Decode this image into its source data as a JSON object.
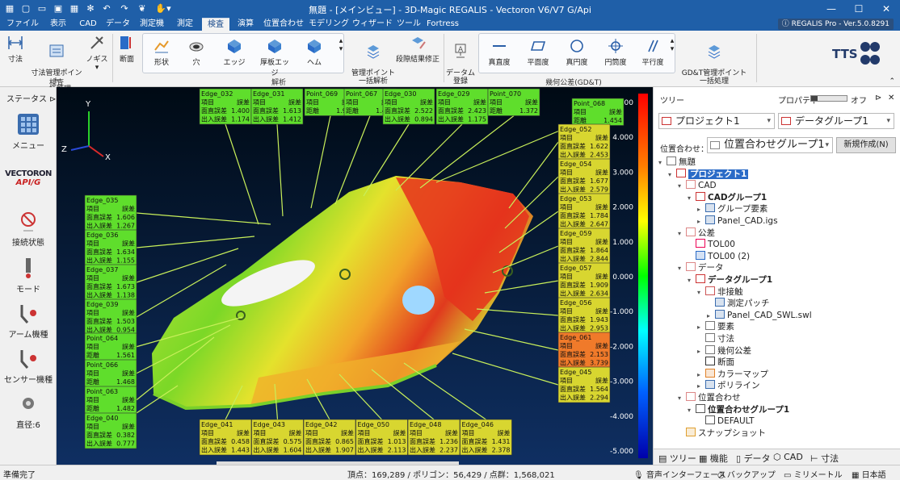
{
  "titlebar": {
    "title": "無題 - [メインビュー] - 3D-Magic REGALIS - Vectoron V6/V7 G/Api"
  },
  "menu": {
    "items": [
      "ファイル",
      "表示",
      "CAD",
      "データ",
      "測定機",
      "測定",
      "検査",
      "演算",
      "位置合わせ",
      "モデリング",
      "ウィザード",
      "ツール",
      "Fortress"
    ],
    "active": "検査",
    "version_badge": "REGALIS Pro - Ver.5.0.8291"
  },
  "ribbon": {
    "dim": "寸法",
    "dim_batch": "寸法管理ポイント\n一括処理",
    "caliper": "ノギス",
    "section": "断面",
    "group_measure": "検査",
    "shape": "形状",
    "hole": "穴",
    "edge": "エッジ",
    "thick_edge": "厚板エッジ",
    "hem": "ヘム",
    "mgmt_batch": "管理ポイント\n一括解析",
    "step_fix": "段隙結果修正",
    "group_analysis": "解析",
    "datum": "データム\n登録",
    "straightness": "真直度",
    "flatness": "平面度",
    "roundness": "真円度",
    "cylindricity": "円筒度",
    "parallelism": "平行度",
    "gdt_batch": "GD&T管理ポイント\n一括処理",
    "group_gdt": "幾何公差(GD&T)",
    "logo": "TTS"
  },
  "left_panel": {
    "status_title": "ステータス",
    "menu": "メニュー",
    "brand_top": "VECTORON",
    "brand_bottom": "API/G",
    "connection": "接続状態",
    "mode": "モード",
    "arm": "アーム機種",
    "sensor": "センサー機種",
    "diameter": "直径:6"
  },
  "scale": {
    "ticks": [
      "5.000",
      "4.000",
      "3.000",
      "2.000",
      "1.000",
      "0.000",
      "-1.000",
      "-2.000",
      "-3.000",
      "-4.000",
      "-5.000"
    ]
  },
  "callouts": [
    {
      "name": "Edge_032",
      "r1": [
        "項目",
        "誤差"
      ],
      "r2": [
        "面直誤差",
        "1.400"
      ],
      "r3": [
        "出入誤差",
        "1.174"
      ],
      "color": "#5fde2c"
    },
    {
      "name": "Edge_031",
      "r1": [
        "項目",
        "誤差"
      ],
      "r2": [
        "面直誤差",
        "1.613"
      ],
      "r3": [
        "出入誤差",
        "1.412"
      ],
      "color": "#5fde2c"
    },
    {
      "name": "Point_069",
      "r1": [
        "項目",
        "誤差"
      ],
      "r2": [
        "距離",
        "1.967"
      ],
      "r3": null,
      "color": "#5fde2c"
    },
    {
      "name": "Point_067",
      "r1": [
        "項目",
        "誤差"
      ],
      "r2": [
        "距離",
        "1.485"
      ],
      "r3": null,
      "color": "#5fde2c"
    },
    {
      "name": "Edge_030",
      "r1": [
        "項目",
        "誤差"
      ],
      "r2": [
        "面直誤差",
        "2.522"
      ],
      "r3": [
        "出入誤差",
        "0.894"
      ],
      "color": "#5fde2c"
    },
    {
      "name": "Edge_029",
      "r1": [
        "項目",
        "誤差"
      ],
      "r2": [
        "面直誤差",
        "2.423"
      ],
      "r3": [
        "出入誤差",
        "1.175"
      ],
      "color": "#5fde2c"
    },
    {
      "name": "Point_070",
      "r1": [
        "項目",
        "誤差"
      ],
      "r2": [
        "距離",
        "1.372"
      ],
      "r3": null,
      "color": "#5fde2c"
    },
    {
      "name": "Point_068",
      "r1": [
        "項目",
        "誤差"
      ],
      "r2": [
        "距離",
        "1.454"
      ],
      "r3": null,
      "color": "#5fde2c"
    },
    {
      "name": "Edge_052",
      "r1": [
        "項目",
        "誤差"
      ],
      "r2": [
        "面直誤差",
        "1.622"
      ],
      "r3": [
        "出入誤差",
        "2.453"
      ],
      "color": "#d8d630"
    },
    {
      "name": "Edge_054",
      "r1": [
        "項目",
        "誤差"
      ],
      "r2": [
        "面直誤差",
        "1.677"
      ],
      "r3": [
        "出入誤差",
        "2.579"
      ],
      "color": "#d8d630"
    },
    {
      "name": "Edge_053",
      "r1": [
        "項目",
        "誤差"
      ],
      "r2": [
        "面直誤差",
        "1.784"
      ],
      "r3": [
        "出入誤差",
        "2.647"
      ],
      "color": "#d8d630"
    },
    {
      "name": "Edge_059",
      "r1": [
        "項目",
        "誤差"
      ],
      "r2": [
        "面直誤差",
        "1.864"
      ],
      "r3": [
        "出入誤差",
        "2.844"
      ],
      "color": "#d8d630"
    },
    {
      "name": "Edge_057",
      "r1": [
        "項目",
        "誤差"
      ],
      "r2": [
        "面直誤差",
        "1.909"
      ],
      "r3": [
        "出入誤差",
        "2.634"
      ],
      "color": "#d8d630"
    },
    {
      "name": "Edge_056",
      "r1": [
        "項目",
        "誤差"
      ],
      "r2": [
        "面直誤差",
        "1.943"
      ],
      "r3": [
        "出入誤差",
        "2.953"
      ],
      "color": "#d8d630"
    },
    {
      "name": "Edge_061",
      "r1": [
        "項目",
        "誤差"
      ],
      "r2": [
        "面直誤差",
        "2.153"
      ],
      "r3": [
        "出入誤差",
        "3.739"
      ],
      "color": "#f07a2a"
    },
    {
      "name": "Edge_045",
      "r1": [
        "項目",
        "誤差"
      ],
      "r2": [
        "面直誤差",
        "1.564"
      ],
      "r3": [
        "出入誤差",
        "2.294"
      ],
      "color": "#d8d630"
    },
    {
      "name": "Edge_035",
      "r1": [
        "項目",
        "誤差"
      ],
      "r2": [
        "面直誤差",
        "1.606"
      ],
      "r3": [
        "出入誤差",
        "1.267"
      ],
      "color": "#5fde2c"
    },
    {
      "name": "Edge_036",
      "r1": [
        "項目",
        "誤差"
      ],
      "r2": [
        "面直誤差",
        "1.634"
      ],
      "r3": [
        "出入誤差",
        "1.155"
      ],
      "color": "#5fde2c"
    },
    {
      "name": "Edge_037",
      "r1": [
        "項目",
        "誤差"
      ],
      "r2": [
        "面直誤差",
        "1.673"
      ],
      "r3": [
        "出入誤差",
        "1.138"
      ],
      "color": "#5fde2c"
    },
    {
      "name": "Edge_039",
      "r1": [
        "項目",
        "誤差"
      ],
      "r2": [
        "面直誤差",
        "1.503"
      ],
      "r3": [
        "出入誤差",
        "0.954"
      ],
      "color": "#5fde2c"
    },
    {
      "name": "Point_064",
      "r1": [
        "項目",
        "誤差"
      ],
      "r2": [
        "距離",
        "1.561"
      ],
      "r3": null,
      "color": "#5fde2c"
    },
    {
      "name": "Point_066",
      "r1": [
        "項目",
        "誤差"
      ],
      "r2": [
        "距離",
        "1.468"
      ],
      "r3": null,
      "color": "#5fde2c"
    },
    {
      "name": "Point_063",
      "r1": [
        "項目",
        "誤差"
      ],
      "r2": [
        "距離",
        "1.482"
      ],
      "r3": null,
      "color": "#5fde2c"
    },
    {
      "name": "Edge_040",
      "r1": [
        "項目",
        "誤差"
      ],
      "r2": [
        "面直誤差",
        "0.382"
      ],
      "r3": [
        "出入誤差",
        "0.777"
      ],
      "color": "#5fde2c"
    },
    {
      "name": "Edge_041",
      "r1": [
        "項目",
        "誤差"
      ],
      "r2": [
        "面直誤差",
        "0.458"
      ],
      "r3": [
        "出入誤差",
        "1.443"
      ],
      "color": "#d8d630"
    },
    {
      "name": "Edge_043",
      "r1": [
        "項目",
        "誤差"
      ],
      "r2": [
        "面直誤差",
        "0.575"
      ],
      "r3": [
        "出入誤差",
        "1.604"
      ],
      "color": "#d8d630"
    },
    {
      "name": "Edge_042",
      "r1": [
        "項目",
        "誤差"
      ],
      "r2": [
        "面直誤差",
        "0.865"
      ],
      "r3": [
        "出入誤差",
        "1.907"
      ],
      "color": "#d8d630"
    },
    {
      "name": "Edge_050",
      "r1": [
        "項目",
        "誤差"
      ],
      "r2": [
        "面直誤差",
        "1.013"
      ],
      "r3": [
        "出入誤差",
        "2.113"
      ],
      "color": "#d8d630"
    },
    {
      "name": "Edge_048",
      "r1": [
        "項目",
        "誤差"
      ],
      "r2": [
        "面直誤差",
        "1.236"
      ],
      "r3": [
        "出入誤差",
        "2.237"
      ],
      "color": "#d8d630"
    },
    {
      "name": "Edge_046",
      "r1": [
        "項目",
        "誤差"
      ],
      "r2": [
        "面直誤差",
        "1.431"
      ],
      "r3": [
        "出入誤差",
        "2.378"
      ],
      "color": "#d8d630"
    }
  ],
  "right_panel": {
    "tree_label": "ツリー",
    "property_label": "プロパティ",
    "toggle_off": "オフ",
    "project_combo": "プロジェクト1",
    "datagroup_combo": "データグループ1",
    "align_label": "位置合わせ：",
    "align_combo": "位置合わせグループ1",
    "new_button": "新規作成(N)",
    "tree": [
      "無題",
      "プロジェクト1",
      "CAD",
      "CADグループ1",
      "グループ要素",
      "Panel_CAD.igs",
      "公差",
      "TOL00",
      "TOL00 (2)",
      "データ",
      "データグループ1",
      "非接触",
      "測定パッチ",
      "Panel_CAD_SWL.swl",
      "要素",
      "寸法",
      "幾何公差",
      "断面",
      "カラーマップ",
      "ポリライン",
      "位置合わせ",
      "位置合わせグループ1",
      "DEFAULT",
      "スナップショット"
    ],
    "tabs": [
      "ツリー",
      "機能",
      "データ",
      "CAD",
      "寸法"
    ]
  },
  "statusbar": {
    "ready": "準備完了",
    "counts": "頂点：169,289 / ポリゴン：56,429 / 点群：1,568,021",
    "voice": "音声インターフェース",
    "backup": "バックアップ",
    "unit": "ミリメートル",
    "lang": "日本語"
  },
  "colors": {
    "titlebar": "#1f5fa8",
    "accent": "#2a6bc7",
    "callout_green": "#5fde2c",
    "callout_yellow": "#d8d630",
    "callout_orange": "#f07a2a"
  }
}
